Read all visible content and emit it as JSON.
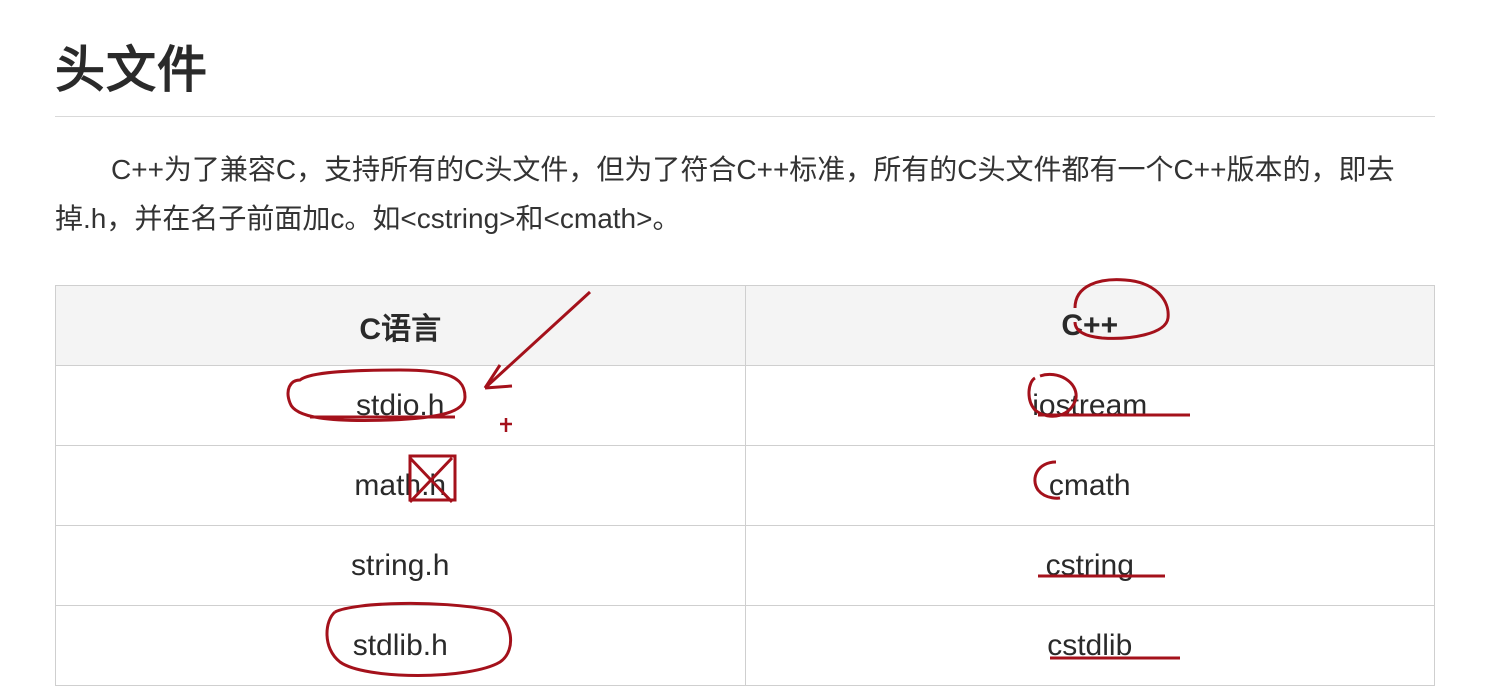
{
  "title": "头文件",
  "intro": "C++为了兼容C，支持所有的C头文件，但为了符合C++标准，所有的C头文件都有一个C++版本的，即去掉.h，并在名子前面加c。如<cstring>和<cmath>。",
  "table": {
    "headers": {
      "c": "C语言",
      "cpp": "C++"
    },
    "rows": [
      {
        "c": "stdio.h",
        "cpp": "iostream"
      },
      {
        "c": "math.h",
        "cpp": "cmath"
      },
      {
        "c": "string.h",
        "cpp": "cstring"
      },
      {
        "c": "stdlib.h",
        "cpp": "cstdlib"
      }
    ]
  }
}
